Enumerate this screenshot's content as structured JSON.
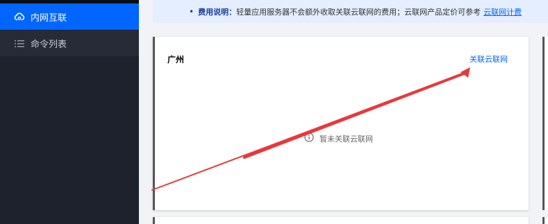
{
  "sidebar": {
    "items": [
      {
        "label": "内网互联",
        "icon": "cloud-link-icon",
        "active": true
      },
      {
        "label": "命令列表",
        "icon": "list-icon",
        "active": false
      }
    ]
  },
  "notice": {
    "label": "费用说明：",
    "text": "轻量应用服务器不会额外收取关联云联网的费用；云联网产品定价可参考",
    "link_text": "云联网计费"
  },
  "card": {
    "region": "广州",
    "action_label": "关联云联网",
    "empty_text": "暂未关联云联网",
    "empty_icon": "info-icon"
  },
  "colors": {
    "accent": "#0066ff",
    "sidebar_bg": "#1e222d",
    "annotation_arrow": "#e8383d"
  }
}
